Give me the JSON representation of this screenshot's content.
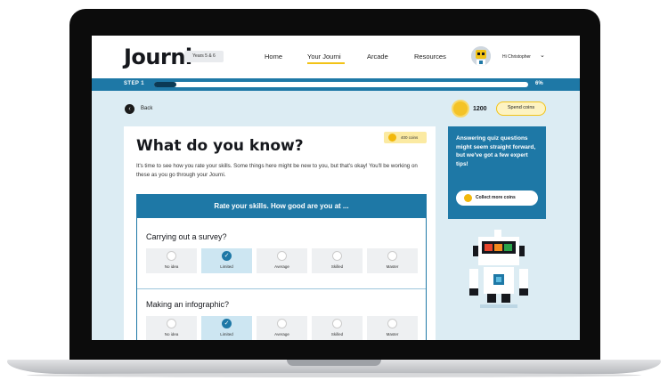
{
  "header": {
    "logo": "Journi",
    "years_badge": "Years 5 & 6",
    "nav": [
      "Home",
      "Your Journi",
      "Arcade",
      "Resources"
    ],
    "active_nav": "Your Journi",
    "user_greeting": "Hi Christopher",
    "avatar_icon": "robot-avatar-icon"
  },
  "progress": {
    "step_label": "STEP 1",
    "percent_label": "6%",
    "fraction": 0.06
  },
  "toolbar": {
    "back_label": "Back",
    "coin_count": "1200",
    "spend_label": "Spend coins"
  },
  "card": {
    "coins_badge": "400 coins",
    "title": "What do you know?",
    "intro": "It's time to see how you rate your skills. Some things here might be new to you, but that's okay! You'll be working on these as you go through your Journi.",
    "rate_header": "Rate your skills. How good are you at ...",
    "questions": [
      {
        "text": "Carrying out a survey?",
        "options": [
          "No idea",
          "Limited",
          "Average",
          "Skilled",
          "Master"
        ],
        "selected": "Limited"
      },
      {
        "text": "Making an infographic?",
        "options": [
          "No idea",
          "Limited",
          "Average",
          "Skilled",
          "Master"
        ],
        "selected": "Limited"
      }
    ]
  },
  "sidebar": {
    "tip": "Answering quiz questions might seem straight forward, but we've got a few expert tips!",
    "collect_label": "Collect more coins"
  },
  "colors": {
    "brand_blue": "#1e78a6",
    "accent_yellow": "#f2c316",
    "page_bg": "#dcecf3"
  }
}
